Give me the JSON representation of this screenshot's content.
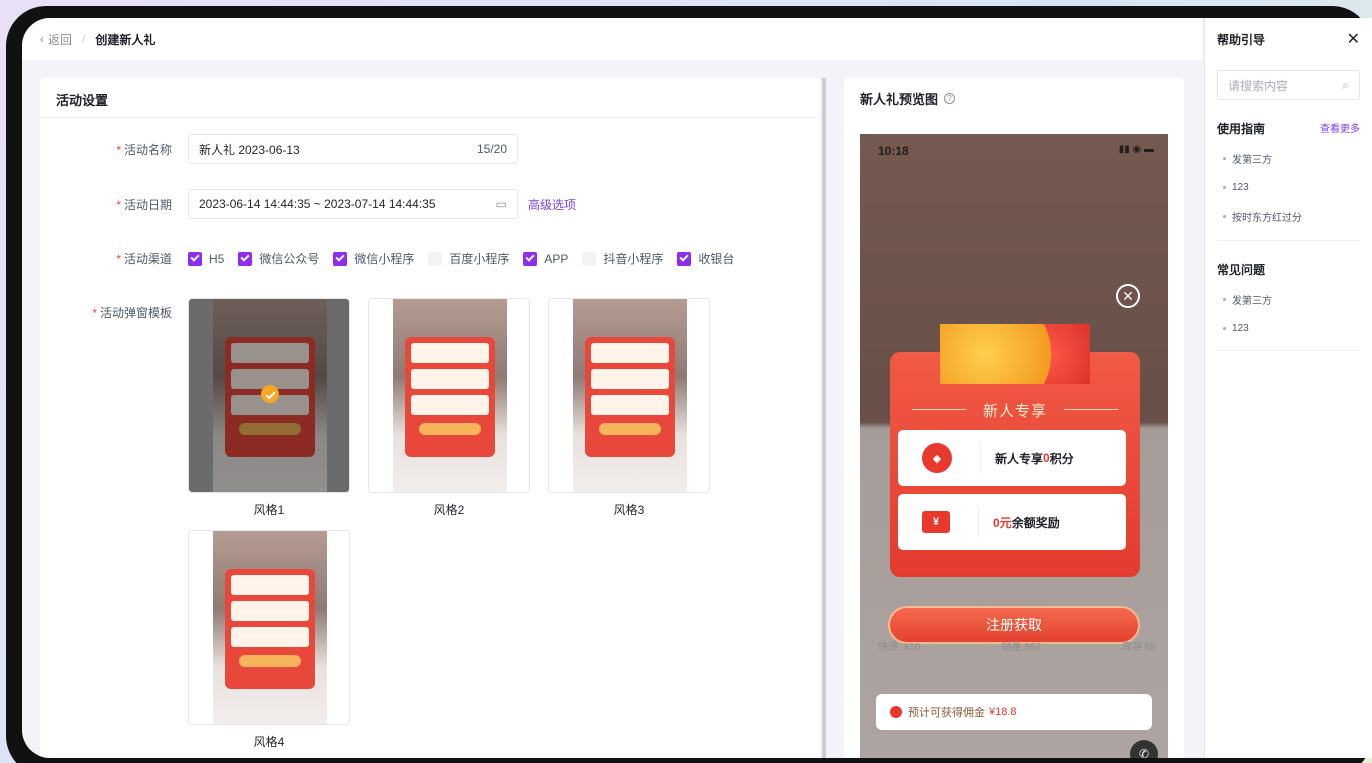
{
  "breadcrumb": {
    "back": "返回",
    "separator": "/",
    "current": "创建新人礼"
  },
  "form": {
    "section_title": "活动设置",
    "name": {
      "label": "活动名称",
      "value": "新人礼  2023-06-13",
      "count": "15/20"
    },
    "date": {
      "label": "活动日期",
      "value": "2023-06-14 14:44:35 ~ 2023-07-14 14:44:35",
      "advanced": "高级选项"
    },
    "channels": {
      "label": "活动渠道",
      "items": [
        {
          "label": "H5",
          "checked": true
        },
        {
          "label": "微信公众号",
          "checked": true
        },
        {
          "label": "微信小程序",
          "checked": true
        },
        {
          "label": "百度小程序",
          "checked": false
        },
        {
          "label": "APP",
          "checked": true
        },
        {
          "label": "抖音小程序",
          "checked": false
        },
        {
          "label": "收银台",
          "checked": true
        }
      ]
    },
    "templates": {
      "label": "活动弹窗模板",
      "items": [
        {
          "name": "风格1",
          "selected": true
        },
        {
          "name": "风格2",
          "selected": false
        },
        {
          "name": "风格3",
          "selected": false
        },
        {
          "name": "风格4",
          "selected": false
        }
      ]
    }
  },
  "preview": {
    "title": "新人礼预览图",
    "help_glyph": "?",
    "status_time": "10:18",
    "popup_title": "新人专享",
    "coupon1": {
      "text_a": "新人专享",
      "text_hl": "0",
      "text_b": "积分"
    },
    "coupon2": {
      "text_hl": "0元",
      "text_b": "余额奖励"
    },
    "register_button": "注册获取",
    "stats": {
      "shipping": "快递: ¥10",
      "sales": "销量 862",
      "stock": "库存 65"
    },
    "commission": {
      "label": "预计可获得佣金",
      "amount": "¥18.8"
    }
  },
  "help": {
    "title": "帮助引导",
    "search_placeholder": "请搜索内容",
    "guide": {
      "title": "使用指南",
      "more": "查看更多",
      "items": [
        "发第三方",
        "123",
        "按时东方红过分"
      ]
    },
    "faq": {
      "title": "常见问题",
      "items": [
        "发第三方",
        "123"
      ]
    }
  },
  "colors": {
    "accent": "#8e2cf0",
    "link": "#7b3ff2",
    "brand_red": "#e9382c"
  }
}
